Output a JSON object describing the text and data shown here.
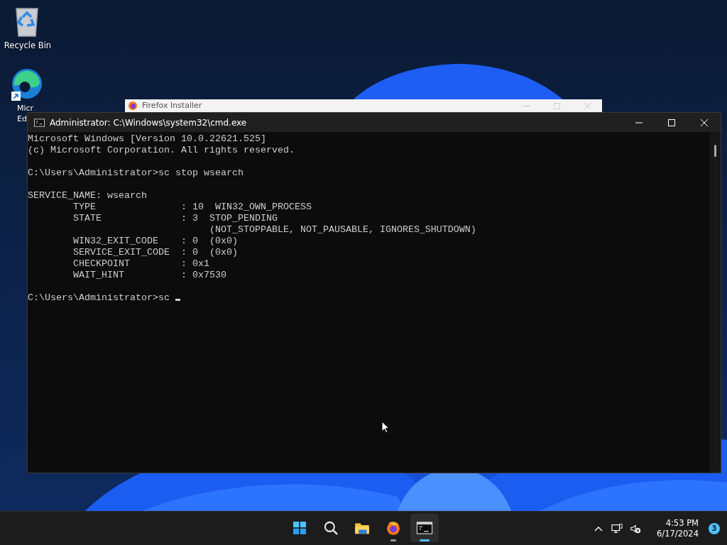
{
  "desktop_icons": [
    {
      "kind": "recycle-bin",
      "label": [
        "Recycle Bin"
      ]
    },
    {
      "kind": "edge",
      "label": [
        "Micr",
        "Ed"
      ],
      "shortcut": true
    }
  ],
  "background_window": {
    "title": "Firefox Installer"
  },
  "console_window": {
    "title": "Administrator: C:\\Windows\\system32\\cmd.exe",
    "blocks": [
      [
        "Microsoft Windows [Version 10.0.22621.525]",
        "(c) Microsoft Corporation. All rights reserved."
      ],
      [
        "C:\\Users\\Administrator>sc stop wsearch"
      ],
      [
        "SERVICE_NAME: wsearch",
        "        TYPE               : 10  WIN32_OWN_PROCESS",
        "        STATE              : 3  STOP_PENDING",
        "                                (NOT_STOPPABLE, NOT_PAUSABLE, IGNORES_SHUTDOWN)",
        "        WIN32_EXIT_CODE    : 0  (0x0)",
        "        SERVICE_EXIT_CODE  : 0  (0x0)",
        "        CHECKPOINT         : 0x1",
        "        WAIT_HINT          : 0x7530"
      ],
      [
        "C:\\Users\\Administrator>sc"
      ]
    ],
    "cursor": true
  },
  "taskbar": {
    "apps": [
      {
        "kind": "start",
        "running": false,
        "active": false
      },
      {
        "kind": "search",
        "running": false,
        "active": false
      },
      {
        "kind": "explorer",
        "running": false,
        "active": false
      },
      {
        "kind": "firefox",
        "running": true,
        "active": false
      },
      {
        "kind": "terminal",
        "running": true,
        "active": true
      }
    ],
    "time": "4:53 PM",
    "date": "6/17/2024",
    "notifications": "3"
  }
}
